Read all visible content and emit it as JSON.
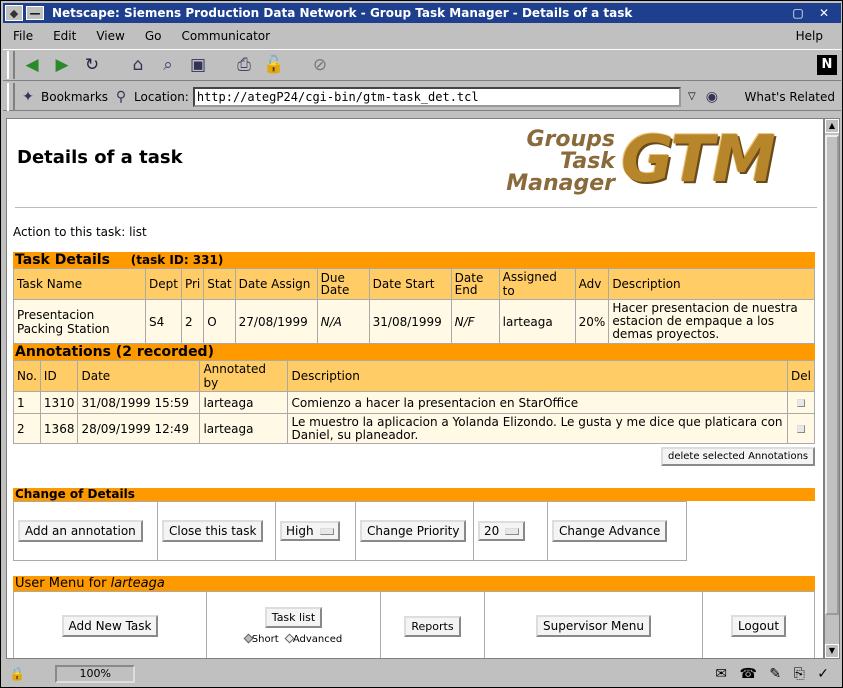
{
  "window": {
    "title": "Netscape: Siemens Production Data Network - Group Task Manager - Details of a task",
    "dash": "—"
  },
  "menu": [
    "File",
    "Edit",
    "View",
    "Go",
    "Communicator"
  ],
  "menu_help": "Help",
  "location": {
    "bookmarks_label": "Bookmarks",
    "location_label": "Location:",
    "url": "http://ategP24/cgi-bin/gtm-task_det.tcl",
    "related_label": "What's Related"
  },
  "status": {
    "zoom": "100%"
  },
  "page": {
    "title": "Details of a task",
    "logo_words": [
      "Groups",
      "Task",
      "Manager"
    ],
    "logo_mark": "GTM",
    "action_text": "Action to this task: list",
    "task_details": {
      "heading": "Task Details",
      "task_id": "(task ID: 331)",
      "headers": [
        "Task Name",
        "Dept",
        "Pri",
        "Stat",
        "Date Assign",
        "Due Date",
        "Date Start",
        "Date End",
        "Assigned to",
        "Adv",
        "Description"
      ],
      "row": [
        "Presentacion Packing Station",
        "S4",
        "2",
        "O",
        "27/08/1999",
        "N/A",
        "31/08/1999",
        "N/F",
        "larteaga",
        "20%",
        "Hacer presentacion de nuestra estacion de empaque a los demas proyectos."
      ]
    },
    "annotations": {
      "heading": "Annotations (2 recorded)",
      "headers": [
        "No.",
        "ID",
        "Date",
        "Annotated by",
        "Description",
        "Del"
      ],
      "rows": [
        [
          "1",
          "1310",
          "31/08/1999 15:59",
          "larteaga",
          "Comienzo a hacer la presentacion en StarOffice"
        ],
        [
          "2",
          "1368",
          "28/09/1999 12:49",
          "larteaga",
          "Le muestro la aplicacion a Yolanda Elizondo. Le gusta y me dice que platicara con Daniel, su planeador."
        ]
      ],
      "delete_button": "delete selected Annotations"
    },
    "change": {
      "heading": "Change of Details",
      "add_annotation": "Add an annotation",
      "close_task": "Close this task",
      "priority_value": "High",
      "change_priority": "Change Priority",
      "advance_value": "20",
      "change_advance": "Change Advance"
    },
    "user_menu": {
      "heading_prefix": "User Menu for ",
      "user": "larteaga",
      "add_task": "Add New Task",
      "task_list": "Task list",
      "short": "Short",
      "advanced": "Advanced",
      "reports": "Reports",
      "supervisor": "Supervisor Menu",
      "logout": "Logout"
    }
  },
  "colors": {
    "title_bar": "#1e3f8e",
    "band": "#ff9900",
    "header_cell": "#ffcc66"
  }
}
